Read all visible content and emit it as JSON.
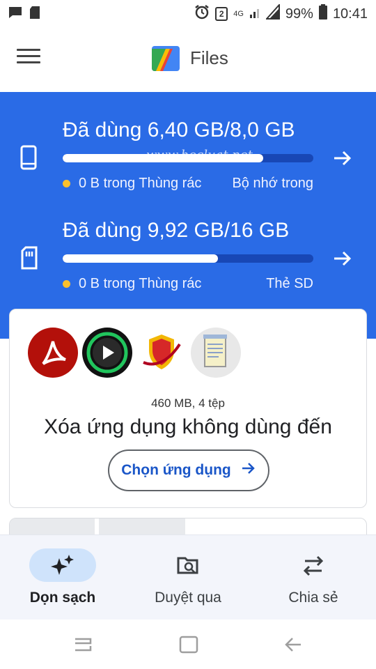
{
  "status_bar": {
    "net_top": "4G",
    "sim_badge": "2",
    "battery": "99%",
    "time": "10:41"
  },
  "app_bar": {
    "title": "Files"
  },
  "storage": {
    "watermark": "www.hocluat.net",
    "internal": {
      "used_text": "Đã dùng 6,40 GB/8,0 GB",
      "used_fraction": 0.8,
      "trash_text": "0 B trong Thùng rác",
      "volume_name": "Bộ nhớ trong"
    },
    "sd": {
      "used_text": "Đã dùng 9,92 GB/16 GB",
      "used_fraction": 0.62,
      "trash_text": "0 B trong Thùng rác",
      "volume_name": "Thẻ SD"
    }
  },
  "cleanup_card": {
    "app_icons": [
      "adobe-acrobat-icon",
      "video-player-icon",
      "shield-app-icon",
      "notepad-icon"
    ],
    "meta": "460 MB, 4 tệp",
    "title": "Xóa ứng dụng không dùng đến",
    "button_label": "Chọn ứng dụng"
  },
  "bottom_nav": {
    "items": [
      {
        "label": "Dọn sạch",
        "icon": "sparkle-icon",
        "active": true
      },
      {
        "label": "Duyệt qua",
        "icon": "folder-search-icon",
        "active": false
      },
      {
        "label": "Chia sẻ",
        "icon": "swap-arrows-icon",
        "active": false
      }
    ]
  },
  "colors": {
    "storage_bg": "#2a6be6",
    "bar_track": "#1847b5",
    "trash_dot": "#fbc02d",
    "accent_text": "#1a56c8",
    "active_pill": "#cfe3fb"
  }
}
